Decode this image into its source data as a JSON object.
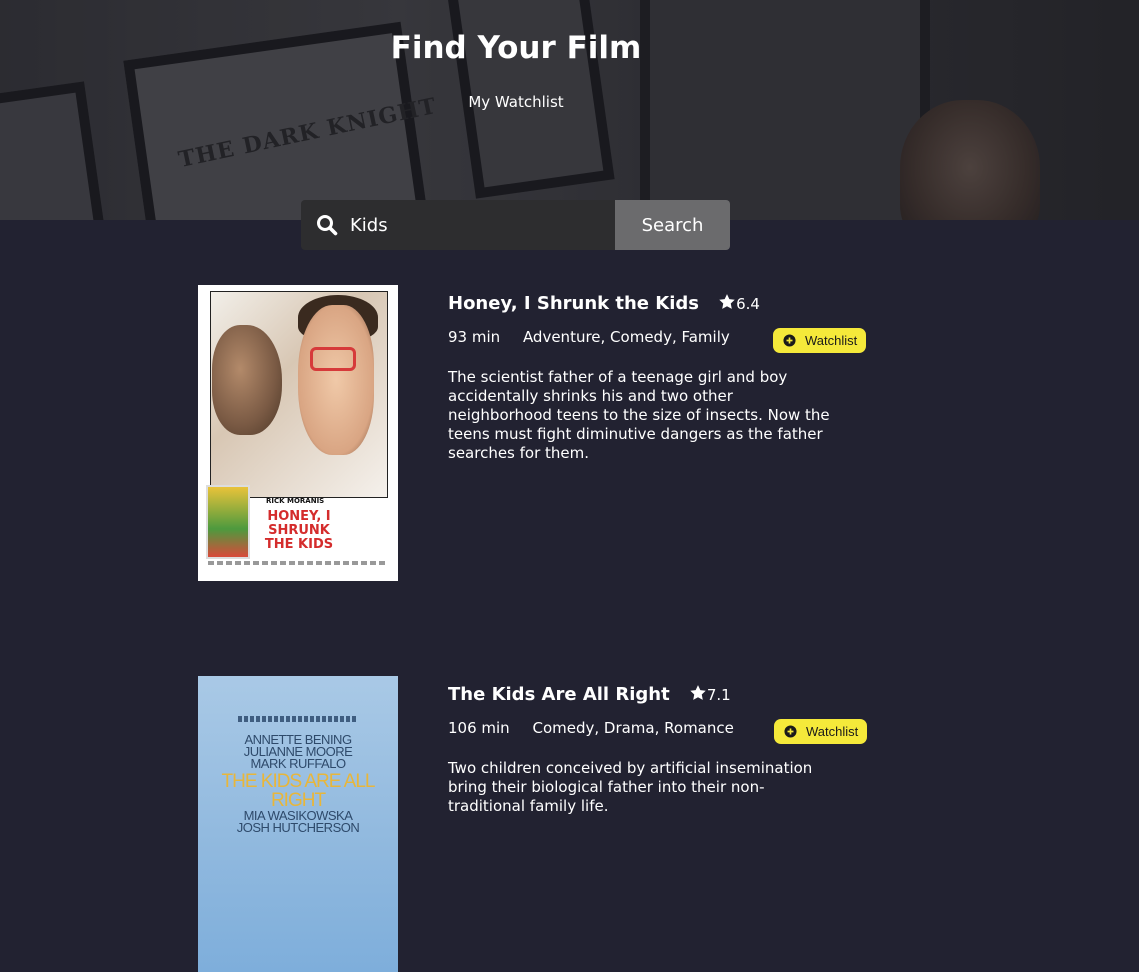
{
  "header": {
    "title": "Find Your Film",
    "watchlist_link": "My Watchlist",
    "background_text": "THE DARK KNIGHT"
  },
  "search": {
    "value": "Kids",
    "button_label": "Search",
    "icon": "search-icon"
  },
  "colors": {
    "background": "#222231",
    "accent": "#f5e93a",
    "search_button": "#6b6b6d"
  },
  "results": [
    {
      "title": "Honey, I Shrunk the Kids",
      "rating": "6.4",
      "runtime": "93 min",
      "genres": "Adventure, Comedy, Family",
      "watchlist_label": "Watchlist",
      "plot": "The scientist father of a teenage girl and boy accidentally shrinks his and two other neighborhood teens to the size of insects. Now the teens must fight diminutive dangers as the father searches for them.",
      "poster": {
        "credit": "RICK MORANIS",
        "title": "HONEY, I SHRUNK THE KIDS"
      }
    },
    {
      "title": "The Kids Are All Right",
      "rating": "7.1",
      "runtime": "106 min",
      "genres": "Comedy, Drama, Romance",
      "watchlist_label": "Watchlist",
      "plot": "Two children conceived by artificial insemination bring their biological father into their non-traditional family life.",
      "poster": {
        "cast_top": [
          "ANNETTE BENING",
          "JULIANNE MOORE",
          "MARK RUFFALO"
        ],
        "title": "THE KIDS ARE ALL RIGHT",
        "cast_bottom": [
          "MIA WASIKOWSKA",
          "JOSH HUTCHERSON"
        ]
      }
    }
  ]
}
